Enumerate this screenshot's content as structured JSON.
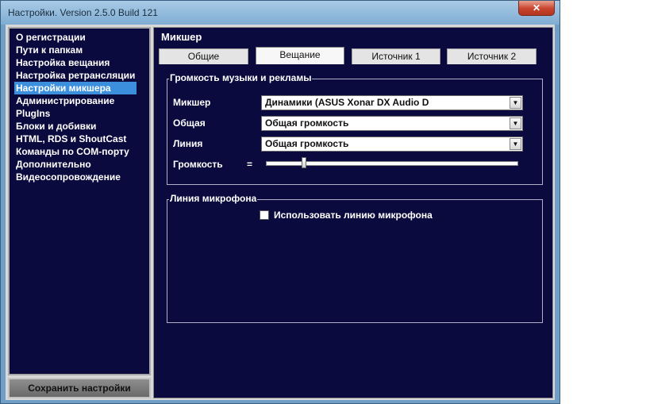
{
  "window": {
    "title": "Настройки. Version 2.5.0 Build 121",
    "close_label": "✕"
  },
  "nav": {
    "items": [
      {
        "label": "О регистрации"
      },
      {
        "label": "Пути к папкам"
      },
      {
        "label": "Настройка вещания"
      },
      {
        "label": "Настройка ретрансляции"
      },
      {
        "label": "Настройки микшера",
        "selected": true
      },
      {
        "label": "Администрирование"
      },
      {
        "label": "PlugIns"
      },
      {
        "label": "Блоки и добивки"
      },
      {
        "label": "HTML, RDS и ShoutCast"
      },
      {
        "label": "Команды по COM-порту"
      },
      {
        "label": "Дополнительно"
      },
      {
        "label": "Видеосопровождение"
      }
    ],
    "save_label": "Сохранить настройки"
  },
  "content": {
    "title": "Микшер",
    "tabs": [
      {
        "label": "Общие"
      },
      {
        "label": "Вещание",
        "active": true
      },
      {
        "label": "Источник 1"
      },
      {
        "label": "Источник 2"
      }
    ],
    "volume_group": {
      "title": "Громкость музыки и рекламы",
      "mixer_label": "Микшер",
      "mixer_value": "Динамики (ASUS Xonar DX Audio D",
      "general_label": "Общая",
      "general_value": "Общая громкость",
      "line_label": "Линия",
      "line_value": "Общая громкость",
      "volume_label": "Громкость",
      "volume_mark": "=",
      "volume_level": 0.15
    },
    "mic_group": {
      "title": "Линия микрофона",
      "use_mic_label": "Использовать линию микрофона",
      "use_mic_checked": false
    }
  },
  "icons": {
    "dropdown": "chevron-down-icon",
    "close": "close-icon"
  },
  "colors": {
    "panel_bg": "#0a0a3e",
    "selection": "#3b8fdc",
    "frame": "#6f9fc6"
  }
}
